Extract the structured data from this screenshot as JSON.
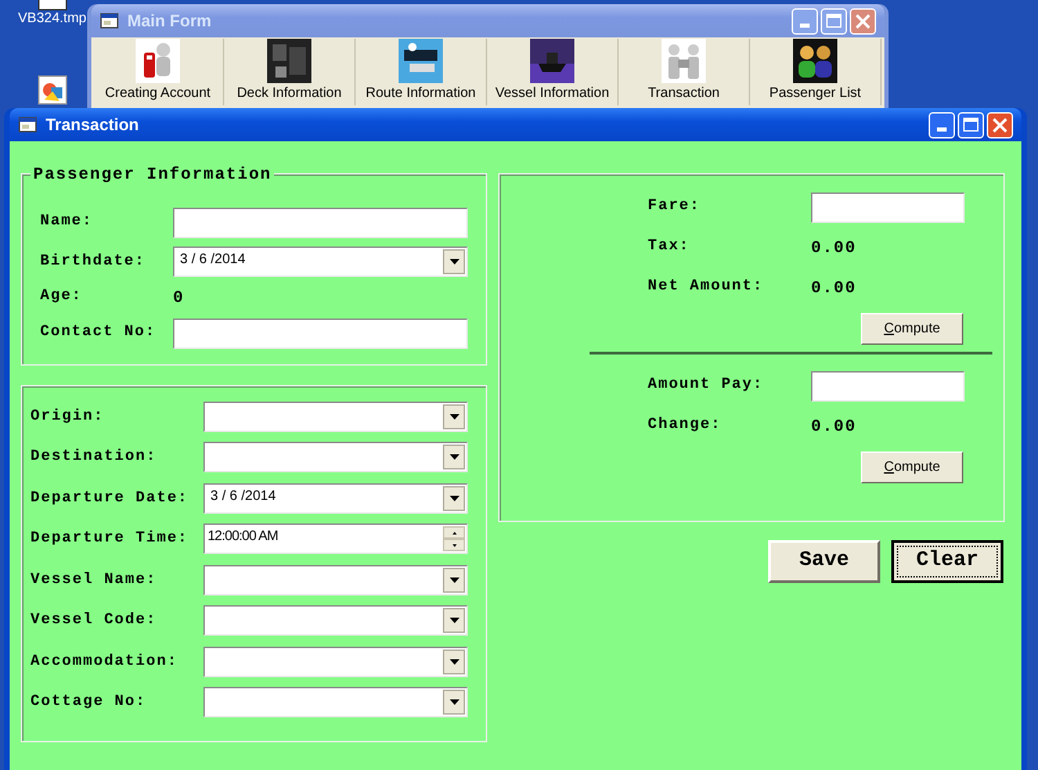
{
  "desktop_icons": [
    {
      "label": "VB324.tmp"
    },
    {
      "kind": "picture"
    }
  ],
  "main_form": {
    "title": "Main Form",
    "active": false,
    "toolbar": [
      {
        "label": "Creating Account"
      },
      {
        "label": "Deck Information"
      },
      {
        "label": "Route Information"
      },
      {
        "label": "Vessel Information"
      },
      {
        "label": "Transaction"
      },
      {
        "label": "Passenger List"
      }
    ]
  },
  "transaction_window": {
    "title": "Transaction",
    "active": true,
    "passenger_info": {
      "legend": "Passenger Information",
      "fields": [
        {
          "label": "Name:",
          "kind": "text"
        },
        {
          "label": "Birthdate:",
          "kind": "date",
          "value": "3 / 6 /2014"
        },
        {
          "label": "Age:",
          "kind": "readout",
          "value": "0"
        },
        {
          "label": "Contact No:",
          "kind": "text"
        }
      ]
    },
    "trip_info": {
      "fields": [
        {
          "label": "Origin:",
          "kind": "combo"
        },
        {
          "label": "Destination:",
          "kind": "combo"
        },
        {
          "label": "Departure Date:",
          "kind": "date",
          "value": "3 / 6 /2014"
        },
        {
          "label": "Departure Time:",
          "kind": "time",
          "value": "12:00:00 AM"
        },
        {
          "label": "Vessel Name:",
          "kind": "combo"
        },
        {
          "label": "Vessel Code:",
          "kind": "combo"
        },
        {
          "label": "Accommodation:",
          "kind": "combo"
        },
        {
          "label": "Cottage No:",
          "kind": "combo"
        }
      ]
    },
    "payment": {
      "rows": [
        {
          "kind": "input",
          "label": "Fare:"
        },
        {
          "kind": "readout",
          "label": "Tax:",
          "value": "0.00"
        },
        {
          "kind": "readout",
          "label": "Net Amount:",
          "value": "0.00"
        },
        {
          "kind": "button",
          "label": "Compute"
        },
        {
          "kind": "divider"
        },
        {
          "kind": "input",
          "label": "Amount Pay:"
        },
        {
          "kind": "readout",
          "label": "Change:",
          "value": "0.00"
        },
        {
          "kind": "button",
          "label": "Compute"
        }
      ]
    },
    "actions": [
      {
        "label": "Save",
        "focused": false
      },
      {
        "label": "Clear",
        "focused": true
      }
    ]
  }
}
